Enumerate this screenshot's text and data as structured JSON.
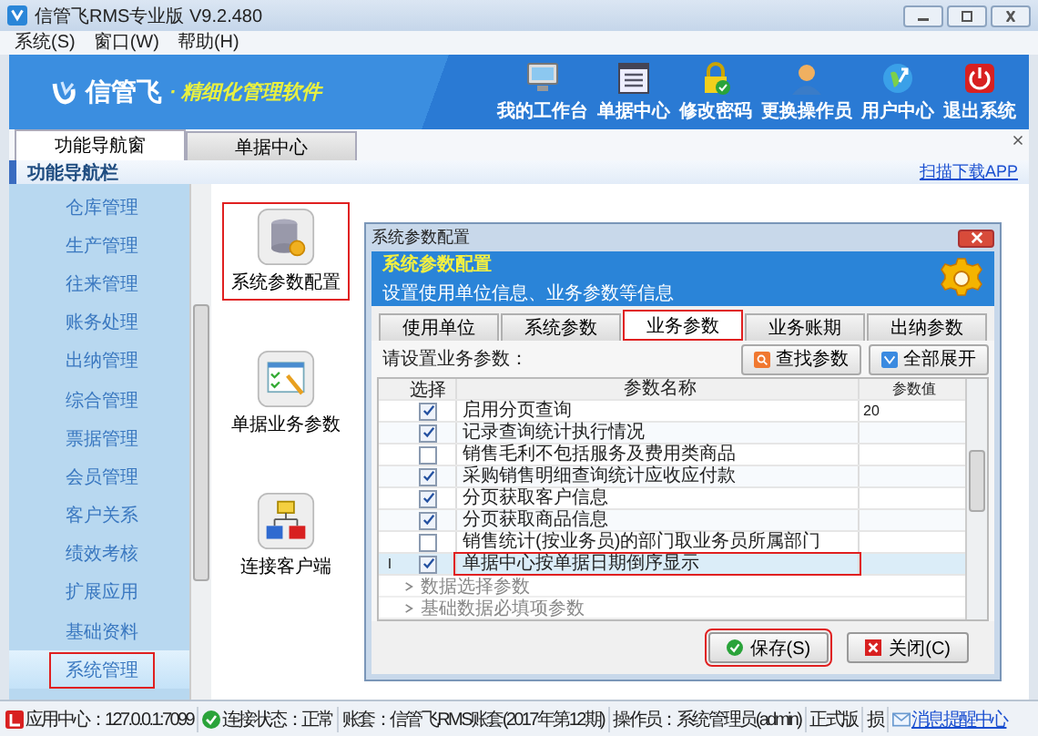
{
  "window": {
    "title": "信管飞RMS专业版 V9.2.480"
  },
  "menu": [
    "系统(S)",
    "窗口(W)",
    "帮助(H)"
  ],
  "banner": {
    "logo": "信管飞",
    "slogan": "· 精细化管理软件",
    "tools": [
      "我的工作台",
      "单据中心",
      "修改密码",
      "更换操作员",
      "用户中心",
      "退出系统"
    ]
  },
  "tabs": [
    {
      "label": "功能导航窗",
      "selected": true
    },
    {
      "label": "单据中心",
      "selected": false
    }
  ],
  "nav_header": {
    "title": "功能导航栏",
    "link": "扫描下载APP"
  },
  "sidebar": {
    "items": [
      {
        "label": "仓库管理",
        "selected": false,
        "highlighted": false
      },
      {
        "label": "生产管理",
        "selected": false,
        "highlighted": false
      },
      {
        "label": "往来管理",
        "selected": false,
        "highlighted": false
      },
      {
        "label": "账务处理",
        "selected": false,
        "highlighted": false
      },
      {
        "label": "出纳管理",
        "selected": false,
        "highlighted": false
      },
      {
        "label": "综合管理",
        "selected": false,
        "highlighted": false
      },
      {
        "label": "票据管理",
        "selected": false,
        "highlighted": false
      },
      {
        "label": "会员管理",
        "selected": false,
        "highlighted": false
      },
      {
        "label": "客户关系",
        "selected": false,
        "highlighted": false
      },
      {
        "label": "绩效考核",
        "selected": false,
        "highlighted": false
      },
      {
        "label": "扩展应用",
        "selected": false,
        "highlighted": false
      },
      {
        "label": "基础资料",
        "selected": false,
        "highlighted": false
      },
      {
        "label": "系统管理",
        "selected": true,
        "highlighted": true
      }
    ]
  },
  "features": [
    {
      "label": "系统参数配置",
      "highlighted": true
    },
    {
      "label": "单据业务参数",
      "highlighted": false
    },
    {
      "label": "连接客户端",
      "highlighted": false
    }
  ],
  "dialog": {
    "title": "系统参数配置",
    "header_title": "系统参数配置",
    "header_subtitle": "设置使用单位信息、业务参数等信息",
    "tabs": [
      {
        "label": "使用单位",
        "selected": false,
        "highlighted": false
      },
      {
        "label": "系统参数",
        "selected": false,
        "highlighted": false
      },
      {
        "label": "业务参数",
        "selected": true,
        "highlighted": true
      },
      {
        "label": "业务账期",
        "selected": false,
        "highlighted": false
      },
      {
        "label": "出纳参数",
        "selected": false,
        "highlighted": false
      }
    ],
    "prompt": "请设置业务参数：",
    "toolbar_buttons": [
      "查找参数",
      "全部展开"
    ],
    "columns": [
      "选择",
      "参数名称",
      "参数值"
    ],
    "rows": [
      {
        "kind": "param",
        "checked": true,
        "name": "启用分页查询",
        "value": "20",
        "selected": false,
        "highlighted": false
      },
      {
        "kind": "param",
        "checked": true,
        "name": "记录查询统计执行情况",
        "selected": false,
        "highlighted": false
      },
      {
        "kind": "param",
        "checked": false,
        "name": "销售毛利不包括服务及费用类商品",
        "selected": false,
        "highlighted": false
      },
      {
        "kind": "param",
        "checked": true,
        "name": "采购销售明细查询统计应收应付款",
        "selected": false,
        "highlighted": false
      },
      {
        "kind": "param",
        "checked": true,
        "name": "分页获取客户信息",
        "selected": false,
        "highlighted": false
      },
      {
        "kind": "param",
        "checked": true,
        "name": "分页获取商品信息",
        "selected": false,
        "highlighted": false
      },
      {
        "kind": "param",
        "checked": false,
        "name": "销售统计(按业务员)的部门取业务员所属部门",
        "selected": false,
        "highlighted": false
      },
      {
        "kind": "param",
        "checked": true,
        "name": "单据中心按单据日期倒序显示",
        "marker": "I",
        "selected": true,
        "highlighted": true
      },
      {
        "kind": "group",
        "name": "数据选择参数"
      },
      {
        "kind": "group",
        "name": "基础数据必填项参数"
      }
    ],
    "buttons": [
      {
        "label": "保存(S)",
        "highlighted": true
      },
      {
        "label": "关闭(C)",
        "highlighted": false
      }
    ]
  },
  "status_bar": [
    "应用中心：127.0.0.1:7099",
    "连接状态：正常",
    "账套：信管飞RMS账套(2017年第12期)",
    "操作员：系统管理员(admin)",
    "正式版",
    "损",
    "消息提醒中心"
  ]
}
